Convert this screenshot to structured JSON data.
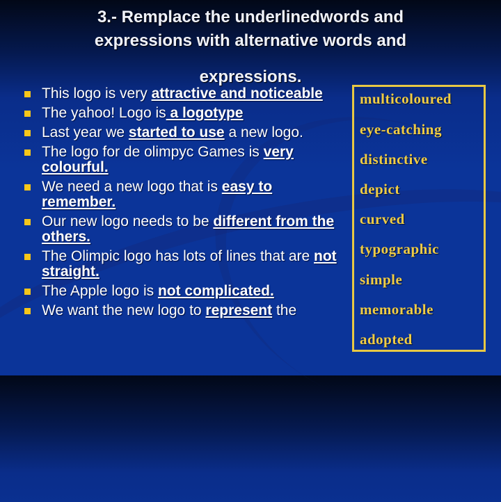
{
  "slide": {
    "title_line1": "3.- Remplace the underlinedwords and",
    "title_line2": "expressions with alternative words and",
    "title_line3": "expressions.",
    "colors": {
      "bullet": "#f6c61a",
      "box_border": "#e8c843",
      "box_text": "#f0cc45",
      "text": "#ffffff"
    },
    "sentences": [
      {
        "pre": "This logo is very ",
        "underlined": "attractive and noticeable",
        "post": ""
      },
      {
        "pre": "The yahoo! Logo is",
        "underlined": " a logotype",
        "post": ""
      },
      {
        "pre": "Last year we ",
        "underlined": "started to use",
        "post": " a new logo."
      },
      {
        "pre": "The logo for de olimpyc Games is ",
        "underlined": "very colourful.",
        "post": ""
      },
      {
        "pre": "We need a new logo that is ",
        "underlined": "easy to remember.",
        "post": ""
      },
      {
        "pre": "Our new logo needs to be ",
        "underlined": "different from the others.",
        "post": ""
      },
      {
        "pre": "The Olimpic logo has lots of lines that are ",
        "underlined": "not straight.",
        "post": ""
      },
      {
        "pre": "The Apple logo is ",
        "underlined": "not complicated.",
        "post": ""
      },
      {
        "pre": "We want the new logo to ",
        "underlined": "represent",
        "post": " the"
      }
    ],
    "word_box": [
      "multicoloured",
      "eye-catching",
      "distinctive",
      "depict",
      "curved",
      "typographic",
      "simple",
      "memorable",
      "adopted"
    ]
  }
}
